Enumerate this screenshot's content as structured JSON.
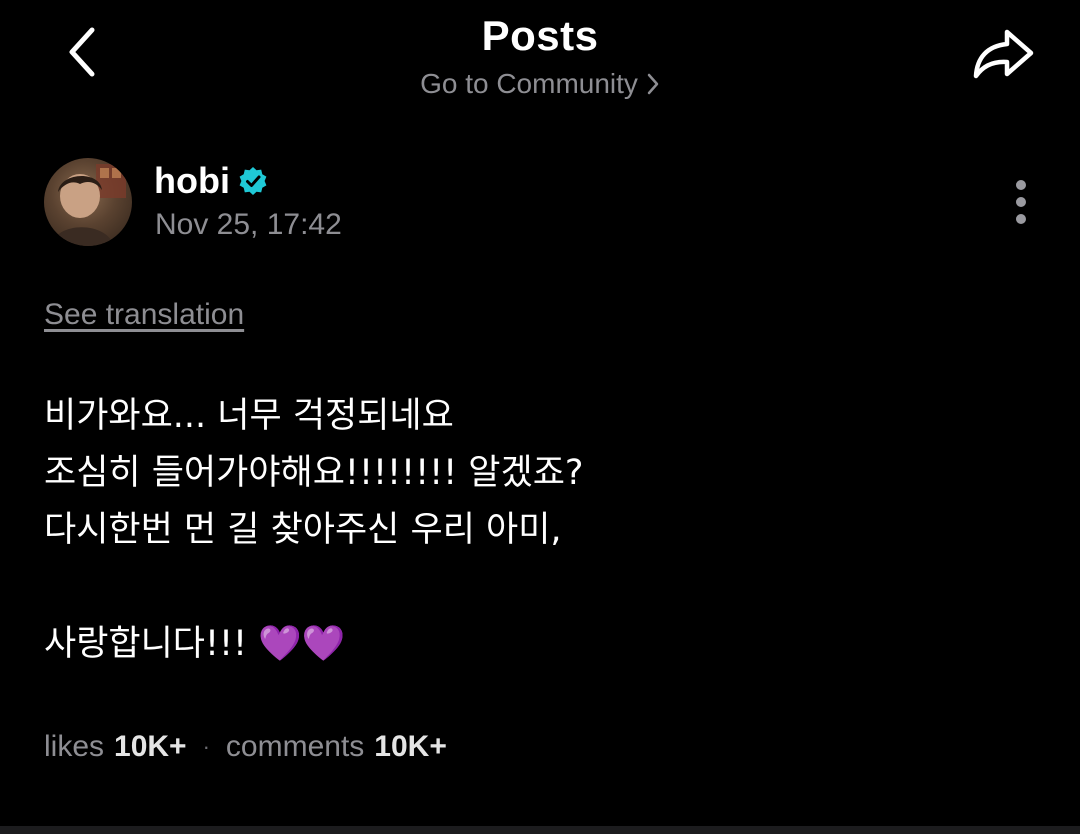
{
  "header": {
    "title": "Posts",
    "community_link": "Go to Community"
  },
  "author": {
    "name": "hobi",
    "verified": true,
    "date": "Nov 25, 17:42"
  },
  "post": {
    "translation_label": "See translation",
    "body": "비가와요... 너무 걱정되네요\n조심히 들어가야해요!!!!!!!! 알겠죠?\n다시한번 먼 길 찾아주신 우리 아미,\n\n사랑합니다!!! 💜💜"
  },
  "stats": {
    "likes_label": "likes",
    "likes_value": "10K+",
    "separator": "·",
    "comments_label": "comments",
    "comments_value": "10K+"
  },
  "colors": {
    "background": "#000000",
    "text_primary": "#ffffff",
    "text_secondary": "#8e8e93",
    "verified_badge": "#1fc9d6"
  },
  "icons": {
    "back": "chevron-left-icon",
    "share": "share-arrow-icon",
    "community_chevron": "chevron-right-icon",
    "verified": "verified-badge-icon",
    "more": "more-vertical-icon"
  }
}
